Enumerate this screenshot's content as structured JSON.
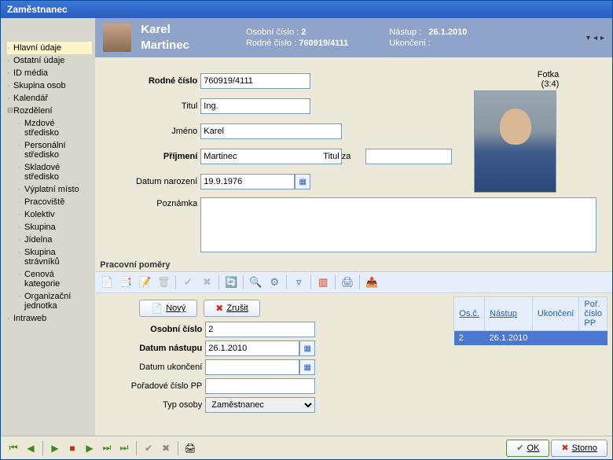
{
  "window": {
    "title": "Zaměstnanec"
  },
  "sidebar": {
    "items": [
      {
        "label": "Hlavní údaje",
        "selected": true
      },
      {
        "label": "Ostatní údaje"
      },
      {
        "label": "ID média"
      },
      {
        "label": "Skupina osob"
      },
      {
        "label": "Kalendář"
      },
      {
        "label": "Rozdělení",
        "parent": true
      },
      {
        "label": "Mzdové středisko",
        "child": true
      },
      {
        "label": "Personální středisko",
        "child": true
      },
      {
        "label": "Skladové středisko",
        "child": true
      },
      {
        "label": "Výplatní místo",
        "child": true
      },
      {
        "label": "Pracoviště",
        "child": true
      },
      {
        "label": "Kolektiv",
        "child": true
      },
      {
        "label": "Skupina",
        "child": true
      },
      {
        "label": "Jídelna",
        "child": true
      },
      {
        "label": "Skupina strávníků",
        "child": true
      },
      {
        "label": "Cenová kategorie",
        "child": true
      },
      {
        "label": "Organizační jednotka",
        "child": true
      },
      {
        "label": "Intraweb"
      }
    ]
  },
  "header": {
    "first_name": "Karel",
    "last_name": "Martinec",
    "osobni_label": "Osobní číslo :",
    "osobni_value": "2",
    "rodne_label": "Rodné číslo :",
    "rodne_value": "760919/4111",
    "nastup_label": "Nástup :",
    "nastup_value": "26.1.2010",
    "ukonceni_label": "Ukončení :",
    "ukonceni_value": ""
  },
  "form": {
    "rodne_label": "Rodné číslo",
    "rodne_value": "760919/4111",
    "titul_label": "Titul",
    "titul_value": "Ing.",
    "jmeno_label": "Jméno",
    "jmeno_value": "Karel",
    "prijmeni_label": "Příjmení",
    "prijmeni_value": "Martinec",
    "titulza_label": "Titul za",
    "titulza_value": "",
    "datum_label": "Datum narození",
    "datum_value": "19.9.1976",
    "poznamka_label": "Poznámka",
    "poznamka_value": "",
    "fotka_label": "Fotka",
    "fotka_ratio": "(3:4)"
  },
  "pomery": {
    "section_title": "Pracovní poměry",
    "novy": "Nový",
    "zrusit": "Zrušit",
    "osobni_label": "Osobní číslo",
    "osobni_value": "2",
    "nastup_label": "Datum nástupu",
    "nastup_value": "26.1.2010",
    "ukonceni_label": "Datum ukončení",
    "ukonceni_value": "",
    "poradi_label": "Pořadové číslo PP",
    "poradi_value": "",
    "typ_label": "Typ osoby",
    "typ_value": "Zaměstnanec",
    "table": {
      "headers": [
        "Os.č.",
        "Nástup",
        "Ukončení",
        "Poř. číslo PP"
      ],
      "rows": [
        {
          "osc": "2",
          "nastup": "26.1.2010",
          "ukonceni": "",
          "por": ""
        }
      ]
    }
  },
  "footer": {
    "ok": "OK",
    "storno": "Storno"
  }
}
